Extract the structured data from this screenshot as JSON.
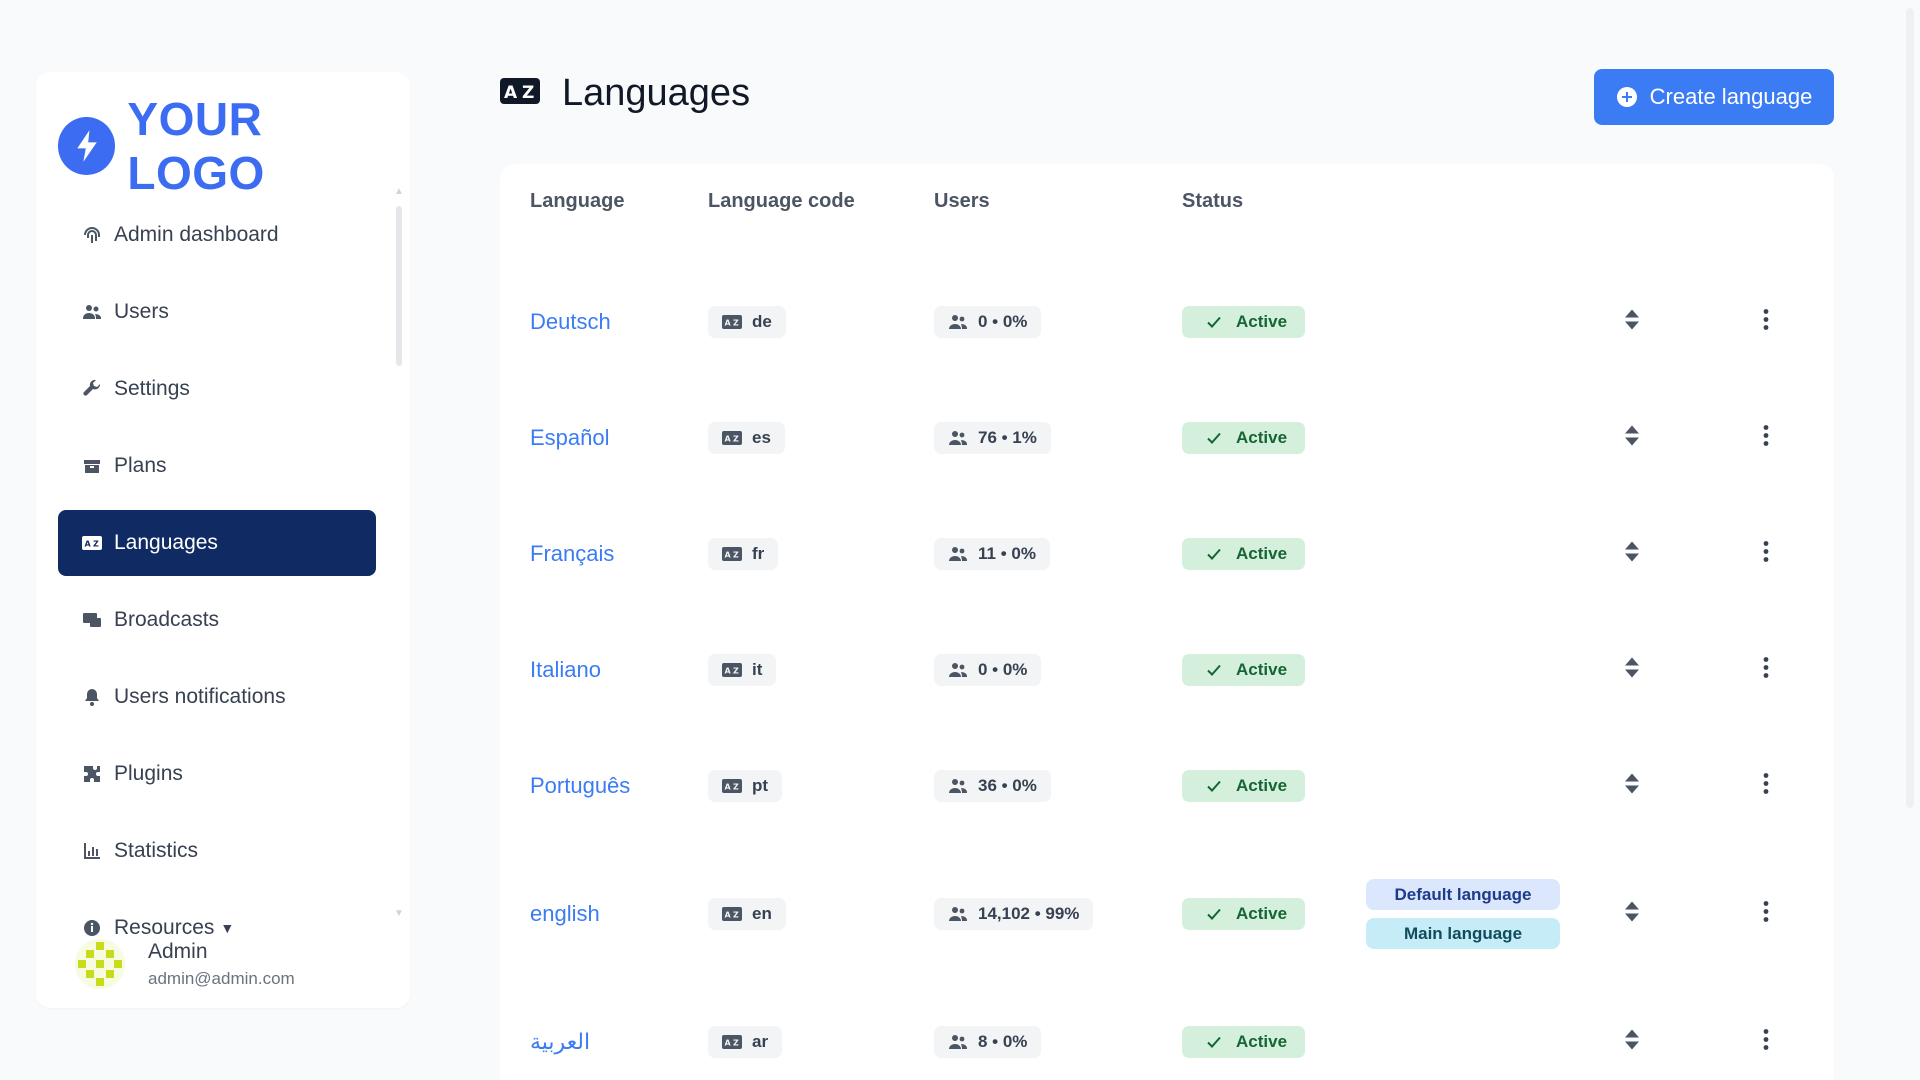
{
  "brand": {
    "logo_text": "YOUR LOGO",
    "accent": "#3b6cf2"
  },
  "sidebar": {
    "items": [
      {
        "label": "Admin dashboard",
        "icon": "fingerprint-icon"
      },
      {
        "label": "Users",
        "icon": "users-icon"
      },
      {
        "label": "Settings",
        "icon": "wrench-icon"
      },
      {
        "label": "Plans",
        "icon": "box-icon"
      },
      {
        "label": "Languages",
        "icon": "language-icon",
        "active": true
      },
      {
        "label": "Broadcasts",
        "icon": "broadcast-icon"
      },
      {
        "label": "Users notifications",
        "icon": "bell-icon"
      },
      {
        "label": "Plugins",
        "icon": "puzzle-icon"
      },
      {
        "label": "Statistics",
        "icon": "chart-icon"
      },
      {
        "label": "Resources",
        "icon": "info-icon"
      }
    ],
    "active_color": "#102a63"
  },
  "user": {
    "name": "Admin",
    "email": "admin@admin.com"
  },
  "page": {
    "title": "Languages",
    "create_button": "Create language"
  },
  "table": {
    "headers": [
      "Language",
      "Language code",
      "Users",
      "Status"
    ],
    "rows": [
      {
        "name": "Deutsch",
        "code": "de",
        "users": "0 • 0%",
        "status": "Active"
      },
      {
        "name": "Español",
        "code": "es",
        "users": "76 • 1%",
        "status": "Active"
      },
      {
        "name": "Français",
        "code": "fr",
        "users": "11 • 0%",
        "status": "Active"
      },
      {
        "name": "Italiano",
        "code": "it",
        "users": "0 • 0%",
        "status": "Active"
      },
      {
        "name": "Português",
        "code": "pt",
        "users": "36 • 0%",
        "status": "Active"
      },
      {
        "name": "english",
        "code": "en",
        "users": "14,102 • 99%",
        "status": "Active",
        "tags": [
          "Default language",
          "Main language"
        ]
      },
      {
        "name": "العربية",
        "code": "ar",
        "users": "8 • 0%",
        "status": "Active"
      }
    ]
  },
  "colors": {
    "link": "#3b7cf4",
    "status_bg": "#d4f0dc",
    "status_text": "#166534"
  }
}
